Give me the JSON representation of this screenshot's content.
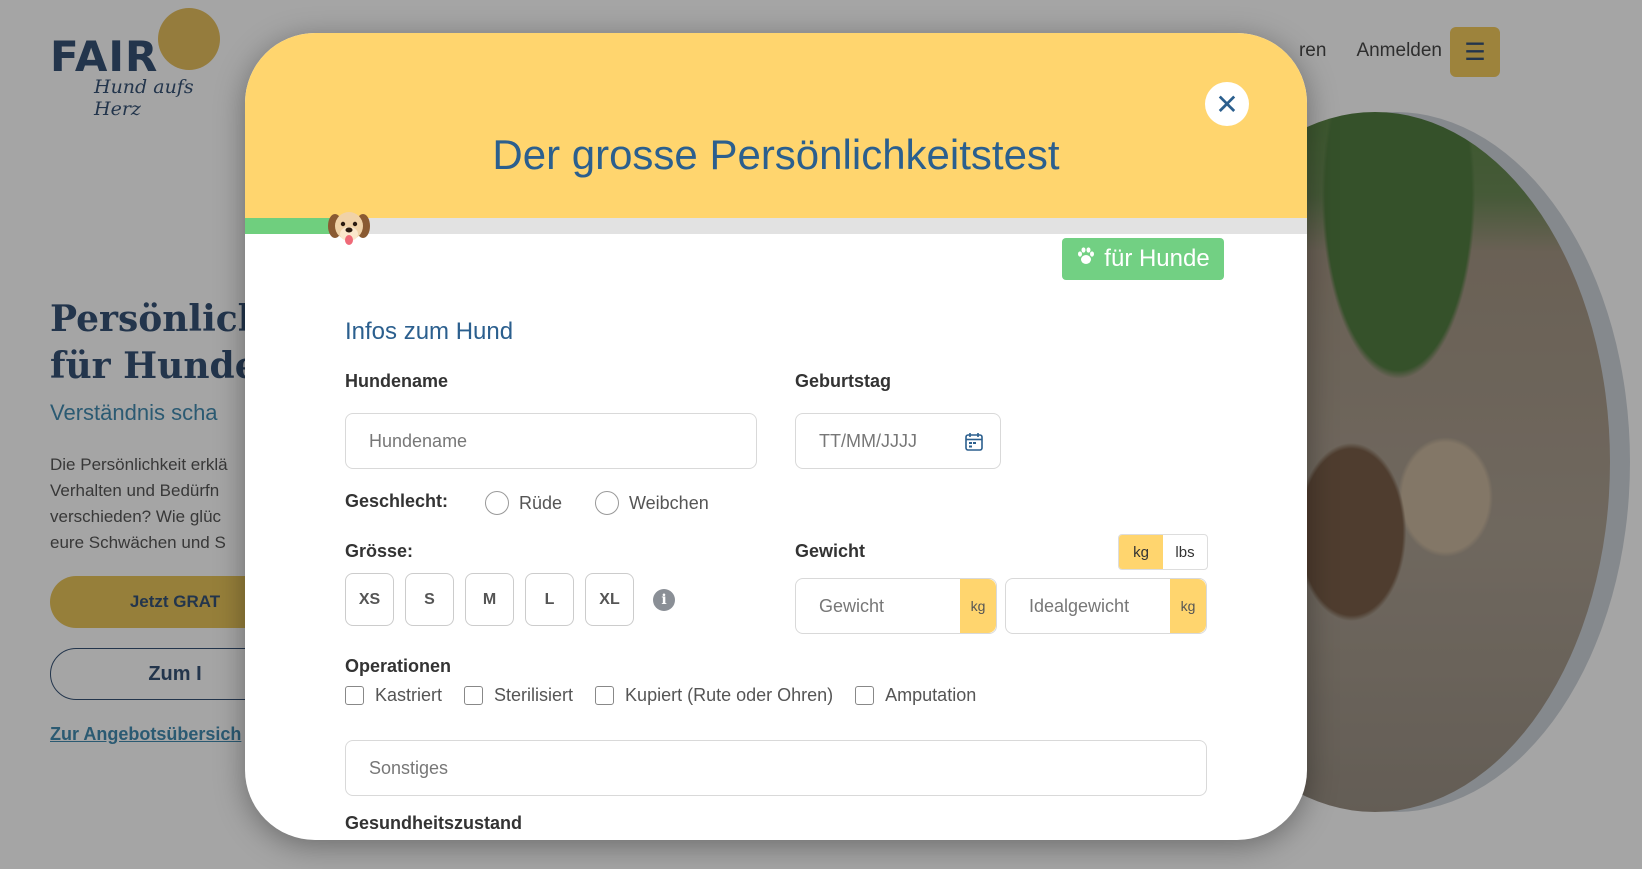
{
  "background": {
    "logo": {
      "brand": "FAIR",
      "tagline": "Hund aufs Herz"
    },
    "nav": {
      "partial_item": "ren",
      "login": "Anmelden",
      "menu_icon": "hamburger-icon"
    },
    "hero": {
      "title_line1": "Persönlich",
      "title_line2": "für Hunde",
      "subtitle": "Verständnis scha",
      "text_lines": [
        "Die Persönlichkeit erklä",
        "Verhalten und Bedürfn",
        "verschieden? Wie glüc",
        "eure Schwächen und S"
      ],
      "cta_primary": "Jetzt GRAT",
      "cta_secondary": "Zum I",
      "link": "Zur Angebotsübersich"
    }
  },
  "modal": {
    "title": "Der grosse Persönlichkeitstest",
    "close_icon": "close-icon",
    "progress_percent": 8,
    "progress_marker_icon": "dog-face-icon",
    "badge": {
      "icon": "paw-icon",
      "label": "für Hunde"
    },
    "section_title": "Infos zum Hund",
    "fields": {
      "name": {
        "label": "Hundename",
        "placeholder": "Hundename",
        "value": ""
      },
      "birthday": {
        "label": "Geburtstag",
        "placeholder": "TT/MM/JJJJ",
        "icon": "calendar-icon"
      },
      "gender": {
        "label": "Geschlecht:",
        "options": [
          "Rüde",
          "Weibchen"
        ]
      },
      "size": {
        "label": "Grösse:",
        "options": [
          "XS",
          "S",
          "M",
          "L",
          "XL"
        ],
        "info_icon": "info-icon"
      },
      "weight": {
        "label": "Gewicht",
        "units": [
          "kg",
          "lbs"
        ],
        "selected_unit": "kg",
        "weight_placeholder": "Gewicht",
        "ideal_placeholder": "Idealgewicht",
        "unit_suffix": "kg"
      },
      "operations": {
        "label": "Operationen",
        "options": [
          "Kastriert",
          "Sterilisiert",
          "Kupiert (Rute oder Ohren)",
          "Amputation"
        ]
      },
      "other": {
        "placeholder": "Sonstiges"
      },
      "health": {
        "label": "Gesundheitszustand"
      }
    }
  },
  "colors": {
    "header_yellow": "#ffd56e",
    "title_blue": "#2b5f8e",
    "badge_green": "#72d083",
    "progress_green": "#6fcf7e"
  }
}
